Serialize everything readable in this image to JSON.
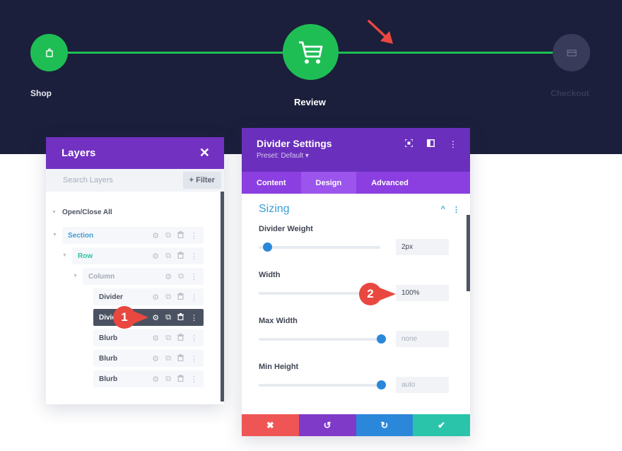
{
  "progress": {
    "steps": [
      {
        "label": "Shop",
        "icon": "shopping-bag-icon",
        "state": "done"
      },
      {
        "label": "Review",
        "icon": "cart-icon",
        "state": "current"
      },
      {
        "label": "Checkout",
        "icon": "credit-card-icon",
        "state": "upcoming"
      }
    ],
    "colors": {
      "active": "#1fbe55",
      "inactive": "#383c5a",
      "background": "#1b1f3b"
    }
  },
  "layers": {
    "title": "Layers",
    "search_placeholder": "Search Layers",
    "filter_label": "+ Filter",
    "open_close_all": "Open/Close All",
    "rows": [
      {
        "label": "Section",
        "color": "#3c9ed4"
      },
      {
        "label": "Row",
        "color": "#2ec4a1"
      },
      {
        "label": "Column",
        "color": "#a3a9b6"
      },
      {
        "label": "Divider",
        "color": "#4b5160"
      },
      {
        "label": "Divider",
        "color": "#ffffff"
      },
      {
        "label": "Blurb",
        "color": "#4b5160"
      },
      {
        "label": "Blurb",
        "color": "#4b5160"
      },
      {
        "label": "Blurb",
        "color": "#4b5160"
      }
    ]
  },
  "settings": {
    "title": "Divider Settings",
    "preset": "Preset: Default ▾",
    "tabs": [
      "Content",
      "Design",
      "Advanced"
    ],
    "active_tab": "Design",
    "section": "Sizing",
    "fields": [
      {
        "label": "Divider Weight",
        "value": "2px",
        "slider": 0.03
      },
      {
        "label": "Width",
        "value": "100%",
        "slider": null
      },
      {
        "label": "Max Width",
        "value": "none",
        "slider": 1.0
      },
      {
        "label": "Min Height",
        "value": "auto",
        "slider": 1.0
      }
    ],
    "footer": {
      "cancel": "✖",
      "undo": "↺",
      "redo": "↻",
      "save": "✔"
    },
    "footer_colors": {
      "cancel": "#ef5555",
      "undo": "#7f3ac8",
      "redo": "#2b87da",
      "save": "#29c4a9"
    }
  },
  "annotations": {
    "badge1": "1",
    "badge2": "2",
    "color": "#e8483f"
  }
}
